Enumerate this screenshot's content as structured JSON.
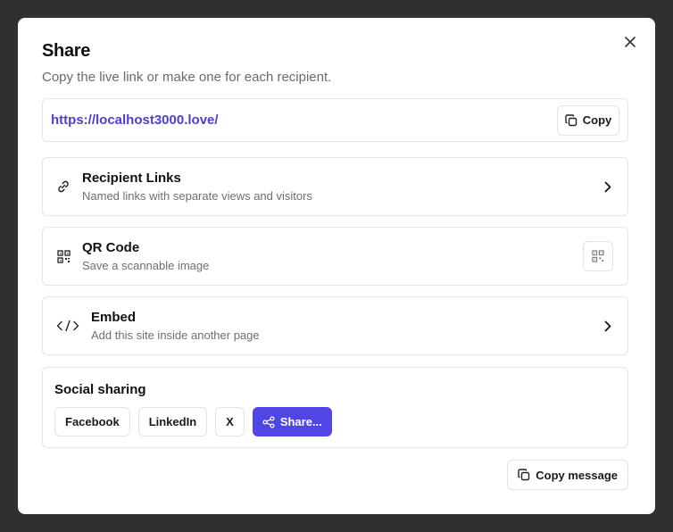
{
  "dialog": {
    "title": "Share",
    "subtitle": "Copy the live link or make one for each recipient.",
    "close_icon": "close-icon"
  },
  "live_link": {
    "url": "https://localhost3000.love/",
    "copy_label": "Copy"
  },
  "options": [
    {
      "icon": "link-icon",
      "title": "Recipient Links",
      "description": "Named links with separate views and visitors",
      "action": "chevron-right-icon"
    },
    {
      "icon": "qr-code-icon",
      "title": "QR Code",
      "description": "Save a scannable image",
      "action": "qr-code-icon"
    },
    {
      "icon": "code-icon",
      "title": "Embed",
      "description": "Add this site inside another page",
      "action": "chevron-right-icon"
    }
  ],
  "social": {
    "title": "Social sharing",
    "buttons": [
      "Facebook",
      "LinkedIn",
      "X"
    ],
    "share_label": "Share..."
  },
  "footer": {
    "copy_message_label": "Copy message"
  },
  "colors": {
    "accent": "#4f46e5",
    "link": "#4b3fd6",
    "backdrop": "#303030"
  }
}
